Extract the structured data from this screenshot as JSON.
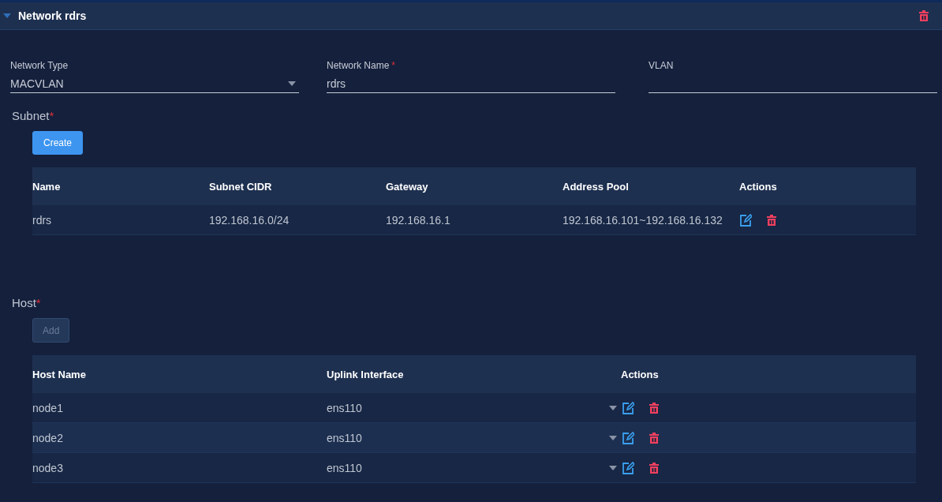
{
  "panel": {
    "title": "Network rdrs",
    "expanded": true
  },
  "fields": [
    {
      "kind": "select",
      "label": "Network Type",
      "value": "MACVLAN"
    },
    {
      "kind": "text",
      "label": "Network Name",
      "required_mark": "*",
      "value": "rdrs"
    },
    {
      "kind": "text",
      "label": "VLAN"
    }
  ],
  "subnet": {
    "label": "Subnet",
    "required_mark": "*",
    "button": {
      "label": "Create",
      "disabled": false
    },
    "columns": [
      "Name",
      "Subnet CIDR",
      "Gateway",
      "Address Pool",
      "Actions"
    ],
    "rows": [
      {
        "cells": [
          "rdrs",
          "192.168.16.0/24",
          "192.168.16.1",
          "192.168.16.101~192.168.16.132"
        ],
        "dropdown": false
      }
    ]
  },
  "host": {
    "label": "Host",
    "required_mark": "*",
    "button": {
      "label": "Add",
      "disabled": true
    },
    "columns": [
      "Host Name",
      "Uplink Interface",
      "Actions"
    ],
    "rows": [
      {
        "cells": [
          "node1",
          "ens110"
        ],
        "dropdown": true
      },
      {
        "cells": [
          "node2",
          "ens110"
        ],
        "dropdown": true
      },
      {
        "cells": [
          "node3",
          "ens110"
        ],
        "dropdown": true
      }
    ]
  }
}
